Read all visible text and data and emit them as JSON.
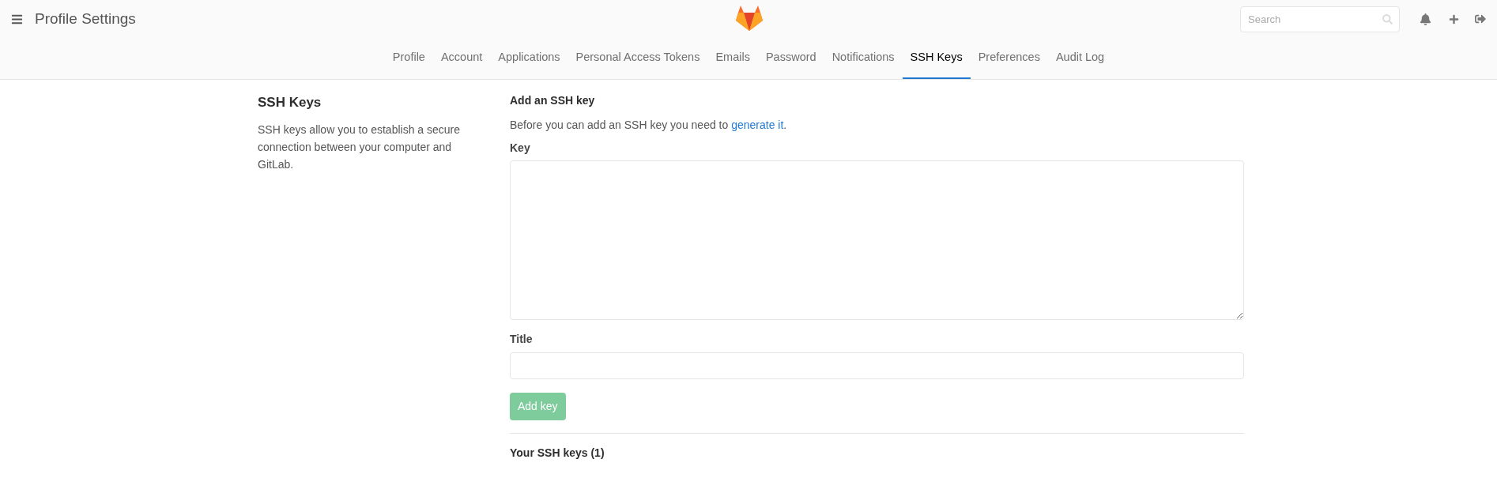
{
  "header": {
    "title": "Profile Settings",
    "search": {
      "placeholder": "Search"
    }
  },
  "tabs": [
    {
      "label": "Profile",
      "selected": false
    },
    {
      "label": "Account",
      "selected": false
    },
    {
      "label": "Applications",
      "selected": false
    },
    {
      "label": "Personal Access Tokens",
      "selected": false
    },
    {
      "label": "Emails",
      "selected": false
    },
    {
      "label": "Password",
      "selected": false
    },
    {
      "label": "Notifications",
      "selected": false
    },
    {
      "label": "SSH Keys",
      "selected": true
    },
    {
      "label": "Preferences",
      "selected": false
    },
    {
      "label": "Audit Log",
      "selected": false
    }
  ],
  "sidebar": {
    "heading": "SSH Keys",
    "description": "SSH keys allow you to establish a secure connection between your computer and GitLab."
  },
  "form": {
    "heading": "Add an SSH key",
    "intro": "Before you can add an SSH key you need to",
    "link": "generate it",
    "after_link": ".",
    "key_label": "Key",
    "title_label": "Title",
    "submit": {
      "label": "Add key",
      "disabled": true
    }
  },
  "keys_heading": "Your SSH keys (1)"
}
